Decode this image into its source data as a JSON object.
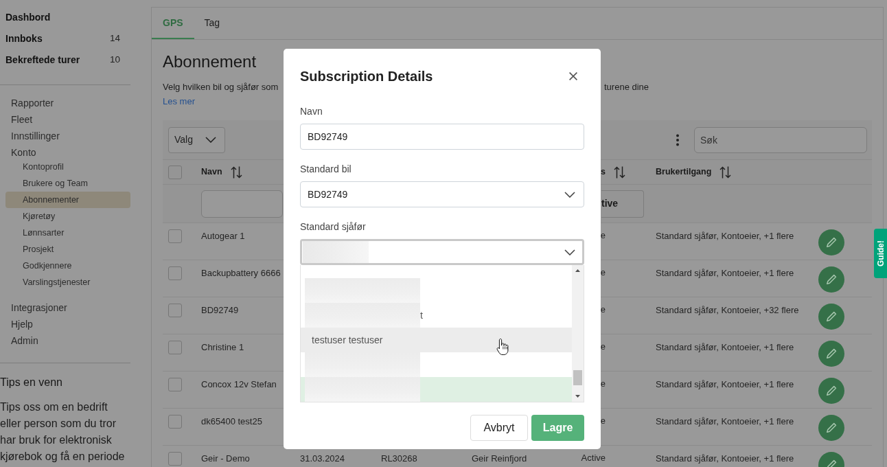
{
  "sidebar": {
    "shortcuts": [
      {
        "label": "Dashbord"
      },
      {
        "label": "Innboks",
        "count": "14"
      },
      {
        "label": "Bekreftede turer",
        "count": "10"
      }
    ],
    "menu": [
      {
        "label": "Rapporter",
        "selected": false
      },
      {
        "label": "Fleet",
        "selected": false
      },
      {
        "label": "Innstillinger",
        "selected": false
      },
      {
        "label": "Konto",
        "selected": false,
        "children": [
          {
            "label": "Kontoprofil",
            "selected": false
          },
          {
            "label": "Brukere og Team",
            "selected": false
          },
          {
            "label": "Abonnementer",
            "selected": true
          },
          {
            "label": "Kjøretøy",
            "selected": false
          },
          {
            "label": "Lønnsarter",
            "selected": false
          },
          {
            "label": "Prosjekt",
            "selected": false
          },
          {
            "label": "Godkjennere",
            "selected": false
          },
          {
            "label": "Varslingstjenester",
            "selected": false
          }
        ]
      },
      {
        "label": "Integrasjoner",
        "selected": false
      },
      {
        "label": "Hjelp",
        "selected": false
      },
      {
        "label": "Admin",
        "selected": false
      }
    ],
    "tip": {
      "title": "Tips en venn",
      "text": "Tips oss om en bedrift eller person som du tror har bruk for elektronisk kjørebok og få en periode"
    }
  },
  "tabs": [
    {
      "label": "GPS",
      "selected": true
    },
    {
      "label": "Tag",
      "selected": false
    }
  ],
  "page": {
    "title": "Abonnement",
    "description_parts": [
      "Velg hvilken bil og sjåfør som",
      "turene dine"
    ],
    "link": "Les mer"
  },
  "toolbar": {
    "bulk_menu": "Valg",
    "search": {
      "placeholder": "Søk"
    }
  },
  "table": {
    "header_checked": false,
    "columns": [
      {
        "kind": "name",
        "label": "Navn",
        "sortable": true
      },
      {
        "kind": "status",
        "label": "s",
        "sortable": true
      },
      {
        "kind": "access",
        "label": "Brukertilgang",
        "sortable": true
      }
    ],
    "filters": {
      "status": "tive"
    },
    "rows": [
      {
        "checked": false,
        "name": "Autogear 1",
        "status": "e",
        "access": "Standard sjåfør, Kontoeier, +1 flere"
      },
      {
        "checked": false,
        "name": "Backupbattery 6666",
        "status": "e",
        "access": "Standard sjåfør, Kontoeier, +1 flere"
      },
      {
        "checked": false,
        "name": "BD92749",
        "status": "e",
        "access": "Standard sjåfør, Kontoeier, +32 flere"
      },
      {
        "checked": false,
        "name": "Christine 1",
        "status": "e",
        "access": "Standard sjåfør, Kontoeier, +1 flere"
      },
      {
        "checked": false,
        "name": "Concox 12v Stefan",
        "status": "e",
        "access": "Standard sjåfør, Kontoeier, +1 flere"
      },
      {
        "checked": false,
        "name": "dk65400 test25",
        "status": "e",
        "access": "Standard sjåfør, Kontoeier, +1 flere"
      },
      {
        "checked": false,
        "name": "Geir - Demo",
        "column_3": "31.03.2024",
        "column_4": "RL30268",
        "column_5": "Geir Reinfjord",
        "status": "Active",
        "access": "Standard sjåfør, Kontoeier, +1 flere"
      }
    ]
  },
  "modal": {
    "title": "Subscription Details",
    "fields": [
      {
        "kind": "text",
        "label": "Navn",
        "value": "BD92749"
      },
      {
        "kind": "select",
        "label": "Standard bil",
        "value": "BD92749",
        "focused": false
      },
      {
        "kind": "select",
        "label": "Standard sjåfør",
        "redacted": true,
        "focused": true,
        "open": true,
        "options": [
          {
            "kind": "redacted",
            "hovered": false,
            "selected": false
          },
          {
            "kind": "redacted",
            "tail": "t",
            "hovered": false,
            "selected": false
          },
          {
            "kind": "text",
            "label": "testuser testuser",
            "hovered": true,
            "selected": false
          },
          {
            "kind": "redacted",
            "hovered": false,
            "selected": false
          },
          {
            "kind": "redacted",
            "hovered": false,
            "selected": true
          }
        ]
      }
    ],
    "buttons": [
      {
        "kind": "secondary",
        "label": "Avbryt"
      },
      {
        "kind": "primary",
        "label": "Lagre"
      }
    ]
  },
  "guide_tab": "Guide!"
}
